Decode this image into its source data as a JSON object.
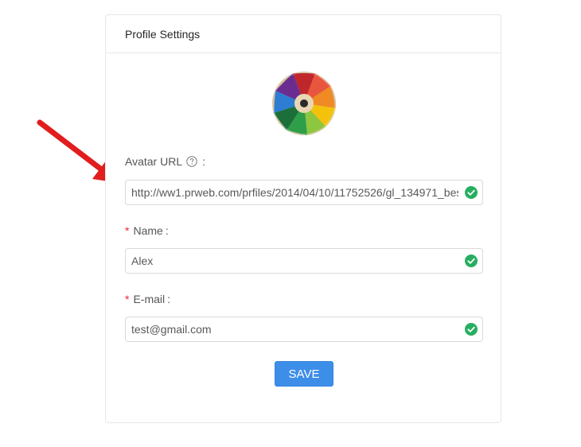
{
  "card": {
    "title": "Profile Settings"
  },
  "avatar": {
    "image": "colored-pencils-avatar"
  },
  "form": {
    "avatar_url": {
      "label": "Avatar URL",
      "colon": ":",
      "value": "http://ww1.prweb.com/prfiles/2014/04/10/11752526/gl_134971_bes",
      "required": false,
      "status": "valid"
    },
    "name": {
      "label": "Name",
      "colon": ":",
      "value": "Alex",
      "required": true,
      "required_mark": "*",
      "status": "valid"
    },
    "email": {
      "label": "E-mail",
      "colon": ":",
      "value": "test@gmail.com",
      "required": true,
      "required_mark": "*",
      "status": "valid"
    }
  },
  "actions": {
    "save_label": "SAVE"
  },
  "icons": {
    "help": "question-circle-icon",
    "valid": "check-circle-icon"
  },
  "colors": {
    "primary": "#3d8ee8",
    "success": "#27ae60",
    "required": "#f5222d",
    "annotation_arrow": "#e11d1d"
  }
}
